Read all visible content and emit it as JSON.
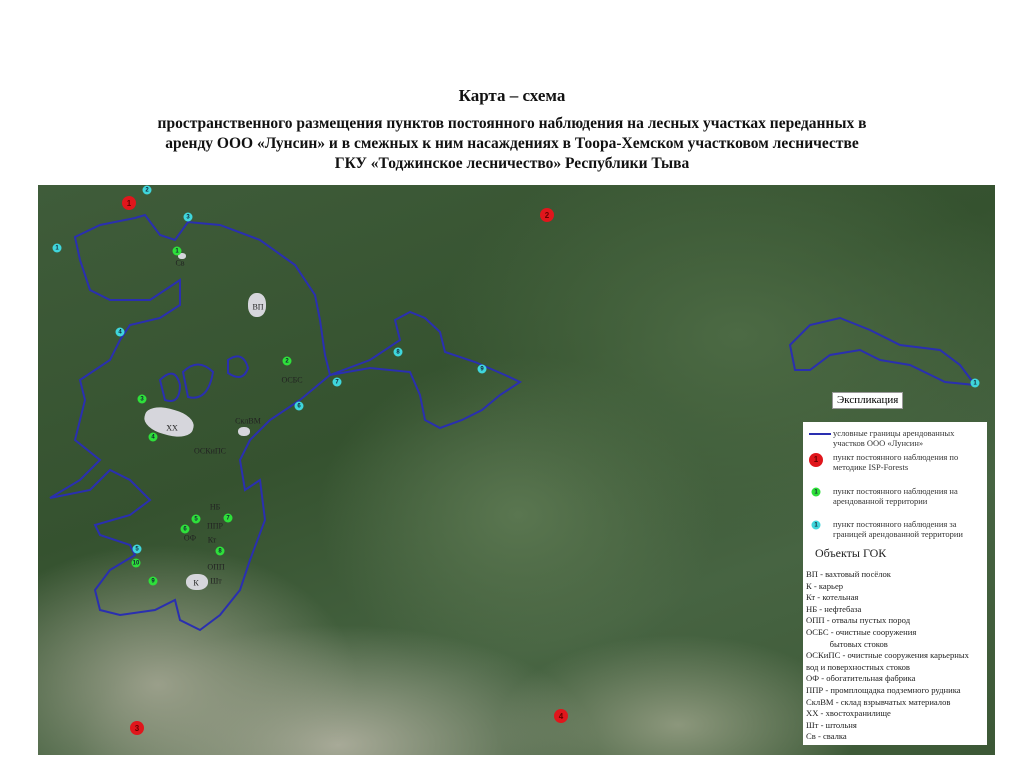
{
  "title": "Карта – схема",
  "subtitle_lines": [
    "пространственного размещения пунктов постоянного  наблюдения на лесных участках переданных в",
    "аренду ООО «Лунсин» и в смежных к ним насаждениях в Тоора-Хемском участковом лесничестве",
    "ГКУ «Тоджинское лесничество» Республики Тыва"
  ],
  "colors": {
    "boundary": "#2a2fb0",
    "red_point": "#e0161c",
    "green_point": "#2ee03a",
    "cyan_point": "#3fd6dc"
  },
  "markers": [
    {
      "kind": "red",
      "label": "1"
    },
    {
      "kind": "red",
      "label": "2"
    },
    {
      "kind": "red",
      "label": "3"
    },
    {
      "kind": "red",
      "label": "4"
    },
    {
      "kind": "cyan",
      "label": "2"
    },
    {
      "kind": "cyan",
      "label": "3"
    },
    {
      "kind": "cyan",
      "label": "1"
    },
    {
      "kind": "cyan",
      "label": "4"
    },
    {
      "kind": "cyan",
      "label": "7"
    },
    {
      "kind": "cyan",
      "label": "6"
    },
    {
      "kind": "cyan",
      "label": "8"
    },
    {
      "kind": "cyan",
      "label": "9"
    },
    {
      "kind": "cyan",
      "label": "5"
    },
    {
      "kind": "cyan",
      "label": "1"
    },
    {
      "kind": "green",
      "label": "1"
    },
    {
      "kind": "green",
      "label": "2"
    },
    {
      "kind": "green",
      "label": "3"
    },
    {
      "kind": "green",
      "label": "4"
    },
    {
      "kind": "green",
      "label": "5"
    },
    {
      "kind": "green",
      "label": "6"
    },
    {
      "kind": "green",
      "label": "7"
    },
    {
      "kind": "green",
      "label": "8"
    },
    {
      "kind": "green",
      "label": "10"
    },
    {
      "kind": "green",
      "label": "9"
    }
  ],
  "map_labels": [
    "Св",
    "ВП",
    "ОСБС",
    "ХХ",
    "СклВМ",
    "ОСКиПС",
    "НБ",
    "ППР",
    "ОФ",
    "Кт",
    "ОПП",
    "Шт",
    "К"
  ],
  "explication": "Экспликация",
  "legend": {
    "items": [
      "условные границы арендованных участков ООО «Лунсин»",
      "пункт постоянного наблюдения по методике ISP-Forests",
      "пункт постоянного наблюдения на арендованной территории",
      "пункт постоянного наблюдения за границей арендованной территории"
    ],
    "sample_label": "1",
    "gok_title": "Объекты ГОК",
    "gok_items": [
      "ВП - вахтовый посёлок",
      "К - карьер",
      "Кт - котельная",
      "НБ - нефтебаза",
      "ОПП - отвалы пустых пород",
      "ОСБС - очистные сооружения",
      "           бытовых стоков",
      "ОСКиПС - очистные сооружения карьерных",
      "вод и поверхностных стоков",
      "ОФ - обогатительная фабрика",
      "ППР - промплощадка подземного рудника",
      "СклВМ - склад взрывчатых материалов",
      "ХХ - хвостохранилище",
      "Шт - штольня",
      "Св - свалка"
    ]
  }
}
